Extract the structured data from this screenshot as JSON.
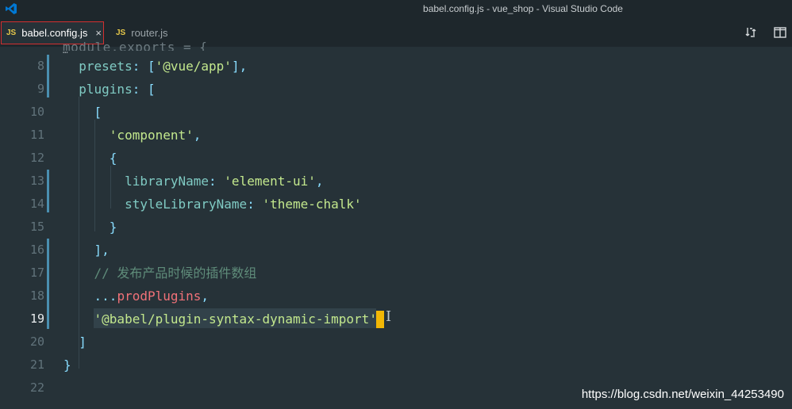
{
  "window": {
    "title": "babel.config.js - vue_shop - Visual Studio Code",
    "app_icon": "vscode-icon",
    "accent": "#0078d4"
  },
  "tabs": [
    {
      "badge": "JS",
      "label": "babel.config.js",
      "close": "×",
      "active": true
    },
    {
      "badge": "JS",
      "label": "router.js",
      "active": false
    }
  ],
  "tab_actions": [
    "compare-changes-icon",
    "split-editor-icon"
  ],
  "editor": {
    "partial_top_line": "module.exports = {",
    "fold_marker": "…",
    "current_line": 19,
    "lines": [
      {
        "num": "8",
        "text": "  presets: ['@vue/app'],"
      },
      {
        "num": "9",
        "text": "  plugins: ["
      },
      {
        "num": "10",
        "text": "    ["
      },
      {
        "num": "11",
        "text": "      'component',"
      },
      {
        "num": "12",
        "text": "      {"
      },
      {
        "num": "13",
        "text": "        libraryName: 'element-ui',"
      },
      {
        "num": "14",
        "text": "        styleLibraryName: 'theme-chalk'"
      },
      {
        "num": "15",
        "text": "      }"
      },
      {
        "num": "16",
        "text": "    ],"
      },
      {
        "num": "17",
        "text": "    // 发布产品时候的插件数组"
      },
      {
        "num": "18",
        "text": "    ...prodPlugins,"
      },
      {
        "num": "19",
        "text": "    '@babel/plugin-syntax-dynamic-import'"
      },
      {
        "num": "20",
        "text": "  ]"
      },
      {
        "num": "21",
        "text": "}"
      },
      {
        "num": "22",
        "text": ""
      }
    ]
  },
  "watermark": "https://blog.csdn.net/weixin_44253490",
  "colors": {
    "background": "#263238",
    "string": "#c3e88d",
    "property": "#80cbc4",
    "variable": "#f07178",
    "comment": "#5f8c7a",
    "cursor": "#f2b705",
    "active_tab_border": "#d32f2f",
    "modified_bar": "#4a8fb0"
  }
}
